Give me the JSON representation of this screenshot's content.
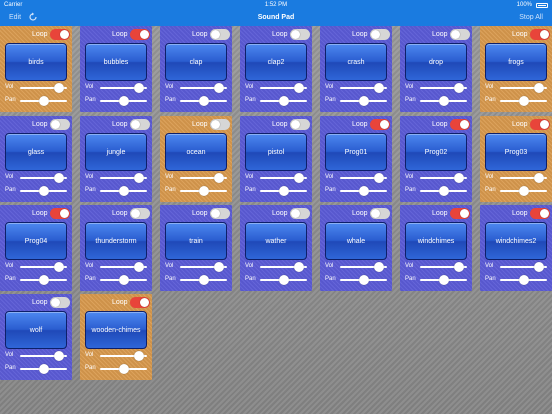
{
  "status_bar": {
    "carrier": "Carrier",
    "time": "1:52 PM",
    "battery": "100%"
  },
  "nav_bar": {
    "edit_label": "Edit",
    "title": "Sound Pad",
    "stop_all_label": "Stop All"
  },
  "labels": {
    "loop": "Loop",
    "vol": "Vol",
    "pan": "Pan"
  },
  "colors": {
    "blue_card": "#5b5bd6",
    "orange_card": "#d99a4e",
    "nav": "#1a7be0",
    "toggle_on": "#e8443a"
  },
  "pads": [
    {
      "name": "birds",
      "color": "orange",
      "loop": true,
      "vol": 0.83,
      "pan": 0.5
    },
    {
      "name": "bubbles",
      "color": "blue",
      "loop": true,
      "vol": 0.83,
      "pan": 0.5
    },
    {
      "name": "clap",
      "color": "blue",
      "loop": false,
      "vol": 0.83,
      "pan": 0.5
    },
    {
      "name": "clap2",
      "color": "blue",
      "loop": false,
      "vol": 0.83,
      "pan": 0.5
    },
    {
      "name": "crash",
      "color": "blue",
      "loop": false,
      "vol": 0.83,
      "pan": 0.5
    },
    {
      "name": "drop",
      "color": "blue",
      "loop": false,
      "vol": 0.83,
      "pan": 0.5
    },
    {
      "name": "frogs",
      "color": "orange",
      "loop": true,
      "vol": 0.83,
      "pan": 0.5
    },
    {
      "name": "glass",
      "color": "blue",
      "loop": false,
      "vol": 0.83,
      "pan": 0.5
    },
    {
      "name": "jungle",
      "color": "blue",
      "loop": false,
      "vol": 0.83,
      "pan": 0.5
    },
    {
      "name": "ocean",
      "color": "orange",
      "loop": false,
      "vol": 0.83,
      "pan": 0.5
    },
    {
      "name": "pistol",
      "color": "blue",
      "loop": false,
      "vol": 0.83,
      "pan": 0.5
    },
    {
      "name": "Prog01",
      "color": "blue",
      "loop": true,
      "vol": 0.83,
      "pan": 0.5
    },
    {
      "name": "Prog02",
      "color": "blue",
      "loop": true,
      "vol": 0.83,
      "pan": 0.5
    },
    {
      "name": "Prog03",
      "color": "orange",
      "loop": true,
      "vol": 0.83,
      "pan": 0.5
    },
    {
      "name": "Prog04",
      "color": "blue",
      "loop": true,
      "vol": 0.83,
      "pan": 0.5
    },
    {
      "name": "thunderstorm",
      "color": "blue",
      "loop": false,
      "vol": 0.83,
      "pan": 0.5
    },
    {
      "name": "train",
      "color": "blue",
      "loop": false,
      "vol": 0.83,
      "pan": 0.5
    },
    {
      "name": "wather",
      "color": "blue",
      "loop": false,
      "vol": 0.83,
      "pan": 0.5
    },
    {
      "name": "whale",
      "color": "blue",
      "loop": false,
      "vol": 0.83,
      "pan": 0.5
    },
    {
      "name": "windchimes",
      "color": "blue",
      "loop": true,
      "vol": 0.83,
      "pan": 0.5
    },
    {
      "name": "windchimes2",
      "color": "blue",
      "loop": true,
      "vol": 0.83,
      "pan": 0.5
    },
    {
      "name": "wolf",
      "color": "blue",
      "loop": false,
      "vol": 0.83,
      "pan": 0.5
    },
    {
      "name": "wooden-chimes",
      "color": "orange",
      "loop": true,
      "vol": 0.83,
      "pan": 0.5
    }
  ]
}
